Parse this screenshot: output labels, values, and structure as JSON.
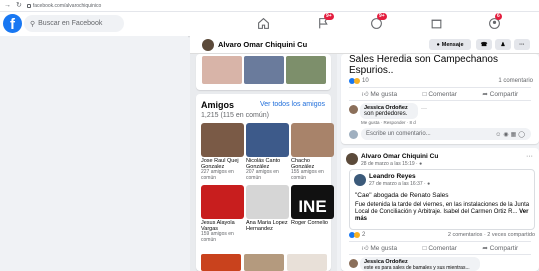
{
  "browser": {
    "url": "facebook.com/alvarochiquinico"
  },
  "fb": {
    "logo": "f",
    "search_placeholder": "Buscar en Facebook",
    "badges": [
      "9+",
      "9+",
      "6"
    ]
  },
  "profile": {
    "name": "Alvaro Omar Chiquini Cu",
    "message_label": "Mensaje"
  },
  "friends": {
    "title": "Amigos",
    "see_all": "Ver todos los amigos",
    "count": "1,215 (115 en común)",
    "list": [
      {
        "name": "Jose Raul Quej Gonzalez",
        "common": "227 amigos en común",
        "color": "#7a5a46"
      },
      {
        "name": "Nicolás Canto González",
        "common": "207 amigos en común",
        "color": "#3d5a8a"
      },
      {
        "name": "Chacho González",
        "common": "155 amigos en común",
        "color": "#a8836a"
      },
      {
        "name": "Jesus Alayola Vargas",
        "common": "159 amigos en común",
        "color": "#c81e1e"
      },
      {
        "name": "Ana Maria Lopez Hernandez",
        "common": "",
        "color": "#d6d6d6"
      },
      {
        "name": "Roger Cornelio",
        "common": "",
        "color": "#111111"
      }
    ],
    "ine_text": "INE"
  },
  "post1": {
    "title": "Sales Heredia son Campechanos Espurios..",
    "reactions": "10",
    "comments": "1 comentario",
    "like": "Me gusta",
    "comment": "Comentar",
    "share": "Compartir",
    "commenter": "Jessica Ordoñez",
    "comment_text": "son perdedores.",
    "comment_meta": "Me gusta · Responder · 8 d",
    "write_placeholder": "Escribe un comentario..."
  },
  "post2": {
    "author": "Alvaro Omar Chiquini Cu",
    "date": "28 de marzo a las 15:19 · ",
    "shared_author": "Leandro Reyes",
    "shared_date": "27 de marzo a las 16:37 · ",
    "quote": "\"Cae\" abogada de Renato Sales",
    "body": "Fue detenida la tarde del viernes, en las instalaciones de la Junta Local de Conciliación y Arbitraje. Isabel del Carmen Ortiz R...",
    "more": "Ver más",
    "reactions": "2",
    "stats": "2 comentarios · 2 veces compartido",
    "like": "Me gusta",
    "comment": "Comentar",
    "share": "Compartir",
    "commenter": "Jessica Ordoñez",
    "comment_text": "este es para sales de bamales y sus mientras..."
  }
}
